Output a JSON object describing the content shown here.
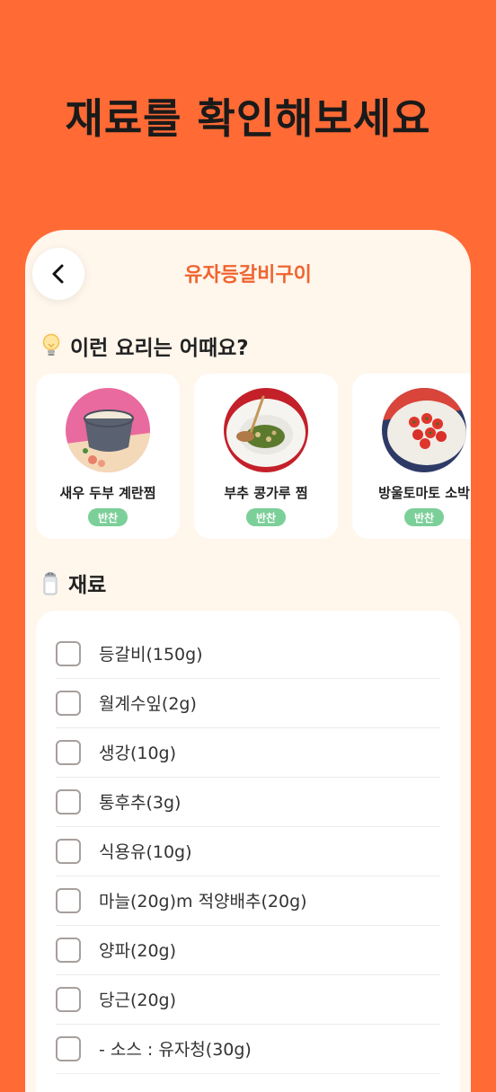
{
  "promo": {
    "title": "재료를 확인해보세요"
  },
  "header": {
    "title": "유자등갈비구이"
  },
  "recommend": {
    "heading": "이런 요리는 어때요?",
    "heading_icon": "lightbulb-icon",
    "items": [
      {
        "name": "새우 두부 계란찜",
        "badge": "반찬"
      },
      {
        "name": "부추 콩가루 찜",
        "badge": "반찬"
      },
      {
        "name": "방울토마토 소박",
        "badge": "반찬"
      }
    ]
  },
  "ingredients": {
    "heading": "재료",
    "heading_icon": "salt-shaker-icon",
    "items": [
      {
        "label": "등갈비(150g)",
        "checked": false
      },
      {
        "label": "월계수잎(2g)",
        "checked": false
      },
      {
        "label": "생강(10g)",
        "checked": false
      },
      {
        "label": "통후추(3g)",
        "checked": false
      },
      {
        "label": "식용유(10g)",
        "checked": false
      },
      {
        "label": "마늘(20g)m 적양배추(20g)",
        "checked": false
      },
      {
        "label": "양파(20g)",
        "checked": false
      },
      {
        "label": "당근(20g)",
        "checked": false
      },
      {
        "label": "- 소스 : 유자청(30g)",
        "checked": false
      }
    ]
  },
  "colors": {
    "background": "#ff6a35",
    "accent": "#f0642f",
    "badge": "#7bcf98",
    "panel": "#fff6ec"
  }
}
